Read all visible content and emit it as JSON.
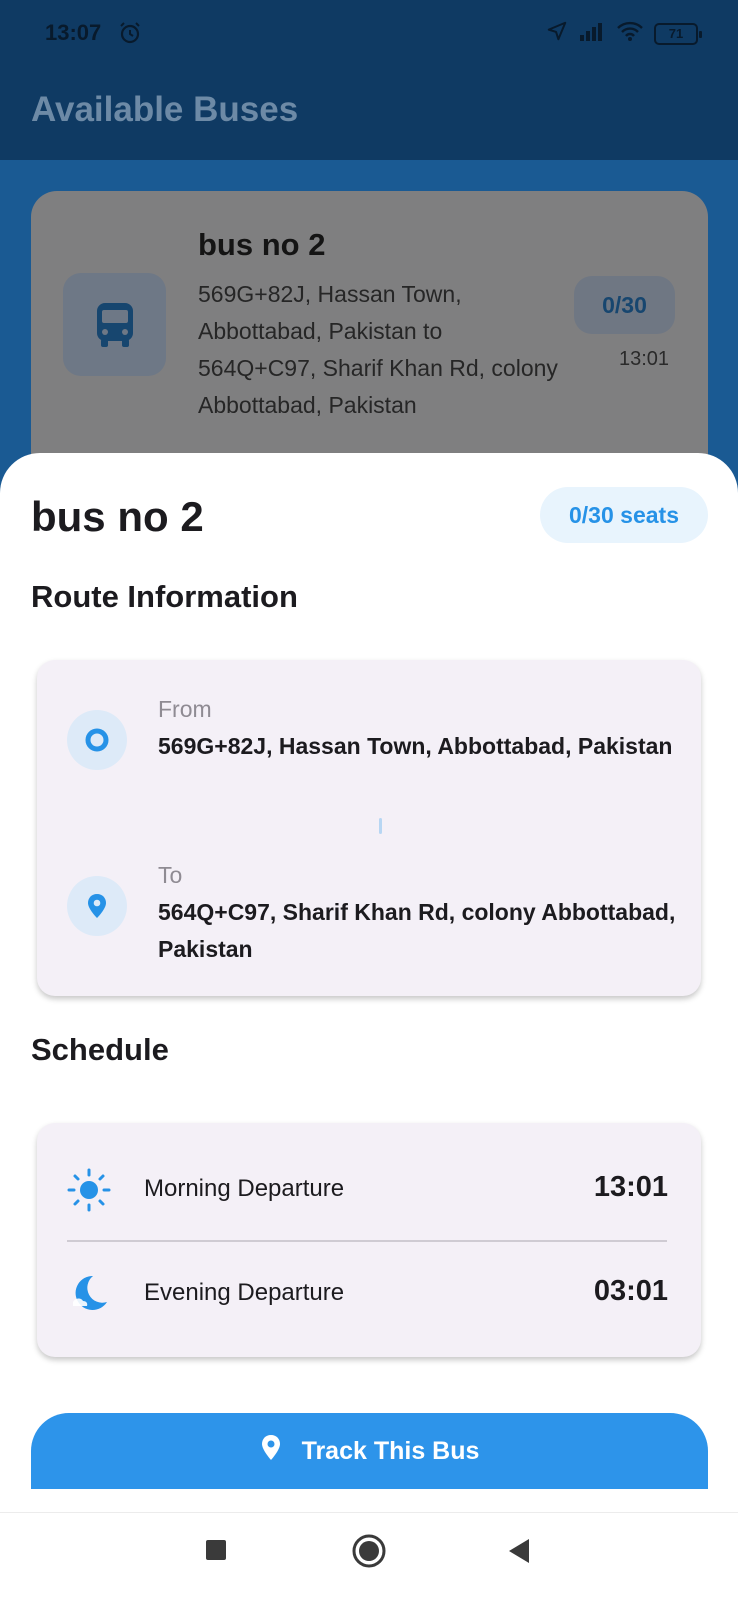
{
  "status_bar": {
    "time": "13:07",
    "battery": "71"
  },
  "app_bar": {
    "title": "Available Buses"
  },
  "bus_list": {
    "items": [
      {
        "title": "bus no 2",
        "route": "569G+82J, Hassan Town, Abbottabad, Pakistan to 564Q+C97, Sharif Khan Rd, colony Abbottabad, Pakistan",
        "seats": "0/30",
        "time": "13:01"
      }
    ]
  },
  "sheet": {
    "title": "bus no 2",
    "seats_chip": "0/30 seats",
    "route_section_title": "Route Information",
    "from_label": "From",
    "from_value": "569G+82J, Hassan Town, Abbottabad, Pakistan",
    "to_label": "To",
    "to_value": "564Q+C97, Sharif Khan Rd, colony Abbottabad, Pakistan",
    "schedule_section_title": "Schedule",
    "schedule": [
      {
        "label": "Morning Departure",
        "time": "13:01",
        "icon": "sun-icon"
      },
      {
        "label": "Evening Departure",
        "time": "03:01",
        "icon": "moon-icon"
      }
    ],
    "track_button_label": "Track This Bus"
  },
  "colors": {
    "accent": "#2d94ea",
    "chip_bg": "#e8f4fd",
    "card_bg": "#f4f0f7"
  }
}
